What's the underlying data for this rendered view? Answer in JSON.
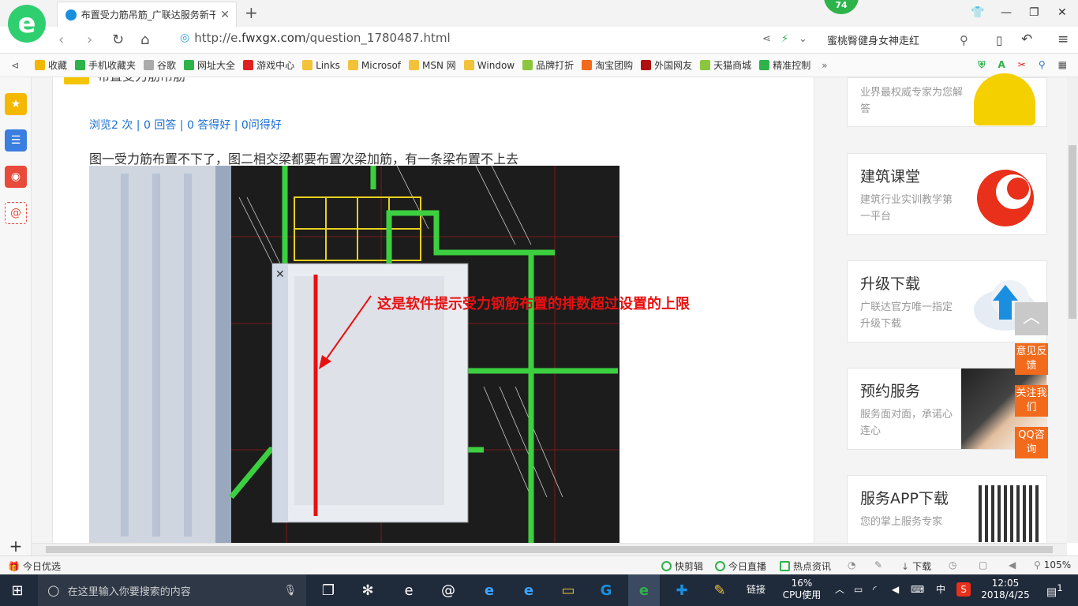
{
  "browser": {
    "tab_title": "布置受力筋吊筋_广联达服务新干",
    "badge_count": "74",
    "url_prefix": "http://e.",
    "url_domain": "fwxgx.com",
    "url_path": "/question_1780487.html",
    "search_text": "蜜桃臀健身女神走红"
  },
  "bookmarks": [
    {
      "label": "收藏",
      "color": "#f2b700"
    },
    {
      "label": "手机收藏夹",
      "color": "#2db34a"
    },
    {
      "label": "谷歌",
      "color": "#aaaaaa"
    },
    {
      "label": "网址大全",
      "color": "#2db34a"
    },
    {
      "label": "游戏中心",
      "color": "#e02020"
    },
    {
      "label": "Links",
      "color": "#f2c23a"
    },
    {
      "label": "Microsof",
      "color": "#f2c23a"
    },
    {
      "label": "MSN 网",
      "color": "#f2c23a"
    },
    {
      "label": "Window",
      "color": "#f2c23a"
    },
    {
      "label": "品牌打折",
      "color": "#8cc63f"
    },
    {
      "label": "淘宝团购",
      "color": "#f26a1b"
    },
    {
      "label": "外国网友",
      "color": "#b01010"
    },
    {
      "label": "天猫商城",
      "color": "#8cc63f"
    },
    {
      "label": "精准控制",
      "color": "#2db34a"
    }
  ],
  "page": {
    "header_title": "布置受力筋吊筋",
    "stats": "浏览2 次 | 0 回答 | 0 答得好 | 0问得好",
    "question": "图一受力筋布置不下了，图二相交梁都要布置次梁加筋，有一条梁布置不上去",
    "annotation": "这是软件提示受力钢筋布置的排数超过设置的上限"
  },
  "right_cards": [
    {
      "title": "",
      "subtitle": "业界最权威专家为您解答"
    },
    {
      "title": "建筑课堂",
      "subtitle": "建筑行业实训教学第一平台"
    },
    {
      "title": "升级下载",
      "subtitle": "广联达官方唯一指定升级下载"
    },
    {
      "title": "预约服务",
      "subtitle": "服务面对面，承诺心连心"
    },
    {
      "title": "服务APP下载",
      "subtitle": "您的掌上服务专家"
    }
  ],
  "float_buttons": [
    "意见反馈",
    "关注我们",
    "QQ咨询"
  ],
  "status_bar": {
    "left": "今日优选",
    "items": [
      "快剪辑",
      "今日直播",
      "热点资讯",
      "下载"
    ],
    "zoom": "105%"
  },
  "taskbar": {
    "search_placeholder": "在这里输入你要搜索的内容",
    "links_label": "链接",
    "cpu_percent": "16%",
    "cpu_label": "CPU使用",
    "ime": "中",
    "time": "12:05",
    "date": "2018/4/25",
    "notif_count": "1"
  }
}
